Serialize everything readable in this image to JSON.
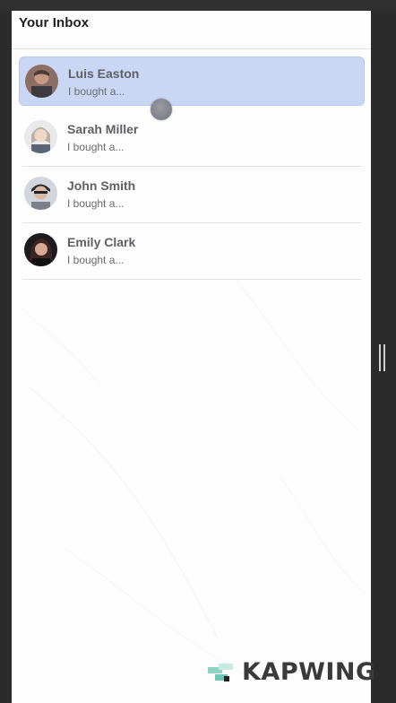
{
  "inbox": {
    "title": "Your Inbox"
  },
  "conversations": [
    {
      "name": "Luis Easton",
      "preview": "I bought a...",
      "avatar": "avatar-luis",
      "selected": true
    },
    {
      "name": "Sarah Miller",
      "preview": "I bought a...",
      "avatar": "avatar-sarah",
      "selected": false
    },
    {
      "name": "John Smith",
      "preview": "I bought a...",
      "avatar": "avatar-john",
      "selected": false
    },
    {
      "name": "Emily Clark",
      "preview": "I bought a...",
      "avatar": "avatar-emily",
      "selected": false
    }
  ],
  "colors": {
    "selected_background": "#c9d6f4",
    "panel_background": "#fdfdfd",
    "frame_background": "#2b2b2b"
  },
  "watermark": {
    "text": "KAPWING"
  }
}
